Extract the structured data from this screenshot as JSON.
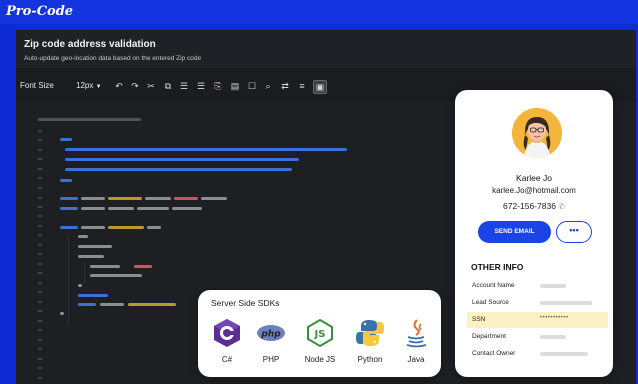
{
  "app": {
    "brand": "Pro-Code"
  },
  "panel": {
    "title": "Zip code address validation",
    "subtitle": "Auto-update geo-location data based on the entered Zip code"
  },
  "toolbar": {
    "font_size_label": "Font Size",
    "font_size_value": "12px",
    "icons": [
      "undo-icon",
      "redo-icon",
      "cut-icon",
      "copy-icon",
      "align-left-icon",
      "align-right-icon",
      "paste-icon",
      "comment-icon",
      "checkbox-icon",
      "find-icon",
      "word-wrap-icon",
      "list-icon",
      "preview-icon"
    ]
  },
  "contact": {
    "name": "Karlee Jo",
    "email": "karlee.Jo@hotmail.com",
    "phone": "672-156-7836",
    "send_label": "SEND EMAIL",
    "more_label": "•••",
    "other_info_title": "OTHER INFO",
    "fields": [
      {
        "label": "Account Name",
        "masked": ""
      },
      {
        "label": "Lead Source",
        "masked": ""
      },
      {
        "label": "SSN",
        "masked": "•••••••••••",
        "highlight": true
      },
      {
        "label": "Department",
        "masked": ""
      },
      {
        "label": "Contact Owner",
        "masked": ""
      }
    ]
  },
  "sdks": {
    "title": "Server Side SDKs",
    "items": [
      {
        "label": "C#",
        "icon": "csharp-icon",
        "color": "#5a2f94"
      },
      {
        "label": "PHP",
        "icon": "php-icon",
        "color": "#6e7fc2"
      },
      {
        "label": "Node JS",
        "icon": "nodejs-icon",
        "color": "#3c8e3c"
      },
      {
        "label": "Python",
        "icon": "python-icon",
        "color": "#3a72a8"
      },
      {
        "label": "Java",
        "icon": "java-icon",
        "color": "#e2692a"
      }
    ]
  },
  "colors": {
    "brand_blue": "#1434e0",
    "accent": "#1a44e6",
    "highlight": "#fbf1c2"
  }
}
